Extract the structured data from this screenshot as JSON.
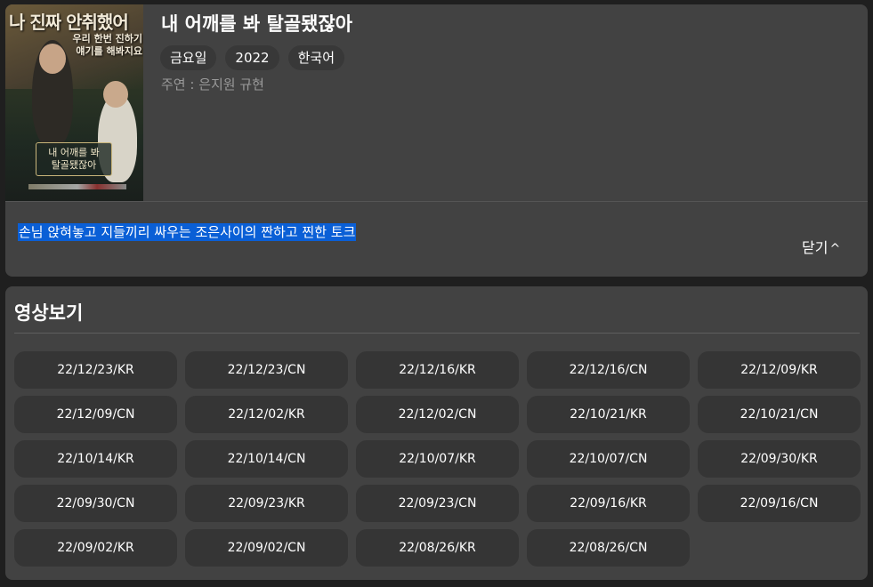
{
  "show": {
    "title": "내 어깨를 봐 탈골됐잖아",
    "tags": [
      "금요일",
      "2022",
      "한국어"
    ],
    "cast": "주연 : 은지원 규현",
    "synopsis": "손님 앉혀놓고 지들끼리 싸우는 조은사이의 짠하고 찐한 토크",
    "close_label": "닫기",
    "close_icon": "chevron-up-icon"
  },
  "poster": {
    "headline": "나 진짜 안취했어",
    "quote": "우리 한번 진하기\n얘기를 해봐지요",
    "sign_text": "내 어깨를 봐\n탈골됐잖아"
  },
  "videos": {
    "section_title": "영상보기",
    "episodes": [
      "22/12/23/KR",
      "22/12/23/CN",
      "22/12/16/KR",
      "22/12/16/CN",
      "22/12/09/KR",
      "22/12/09/CN",
      "22/12/02/KR",
      "22/12/02/CN",
      "22/10/21/KR",
      "22/10/21/CN",
      "22/10/14/KR",
      "22/10/14/CN",
      "22/10/07/KR",
      "22/10/07/CN",
      "22/09/30/KR",
      "22/09/30/CN",
      "22/09/23/KR",
      "22/09/23/CN",
      "22/09/16/KR",
      "22/09/16/CN",
      "22/09/02/KR",
      "22/09/02/CN",
      "22/08/26/KR",
      "22/08/26/CN"
    ]
  },
  "colors": {
    "page_bg": "#1f1f1f",
    "card_bg": "#424242",
    "button_bg": "#353535",
    "selection_highlight": "#0a5fd6",
    "muted_text": "#9a9a9a"
  }
}
